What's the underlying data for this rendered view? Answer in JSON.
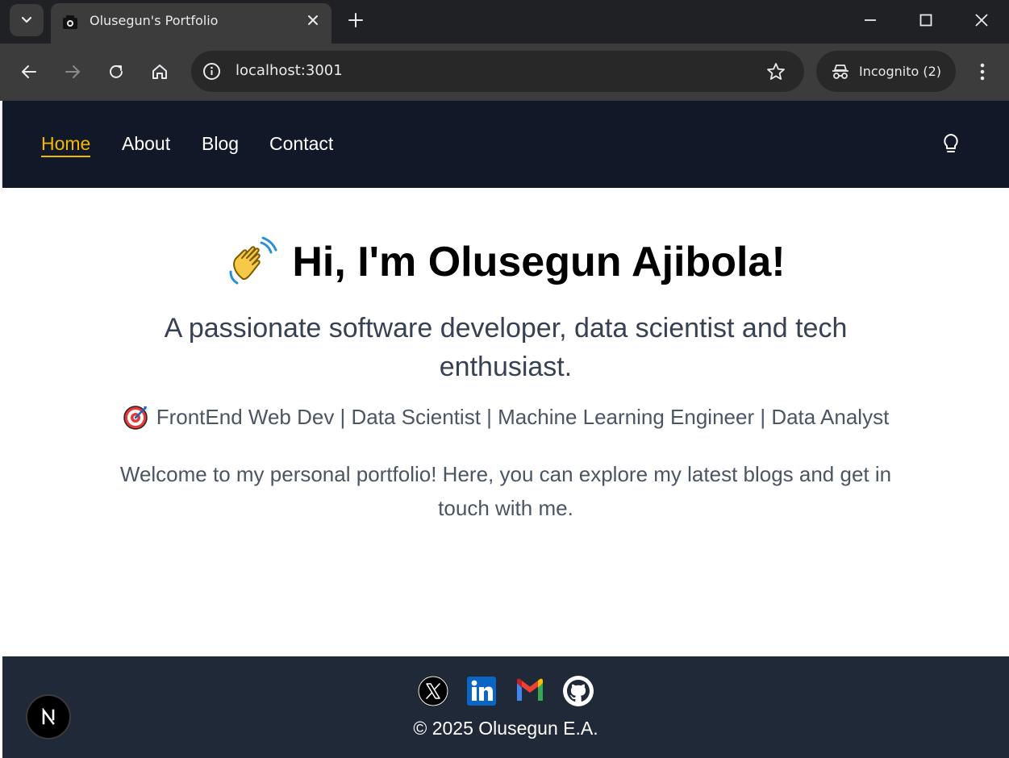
{
  "browser": {
    "tab_title": "Olusegun's Portfolio",
    "url": "localhost:3001",
    "incognito_label": "Incognito (2)"
  },
  "nav": {
    "links": [
      {
        "label": "Home",
        "active": true
      },
      {
        "label": "About",
        "active": false
      },
      {
        "label": "Blog",
        "active": false
      },
      {
        "label": "Contact",
        "active": false
      }
    ],
    "theme_icon": "lightbulb-icon",
    "accent_color": "#f5b800",
    "background": "#111827"
  },
  "hero": {
    "emoji": "waving-hand-icon",
    "title": "Hi, I'm Olusegun Ajibola!",
    "subtitle": "A passionate software developer, data scientist and tech enthusiast.",
    "roles_emoji": "target-icon",
    "roles": "FrontEnd Web Dev | Data Scientist | Machine Learning Engineer | Data Analyst",
    "welcome": "Welcome to my personal portfolio! Here, you can explore my latest blogs and get in touch with me."
  },
  "footer": {
    "socials": [
      "x-icon",
      "linkedin-icon",
      "gmail-icon",
      "github-icon"
    ],
    "copyright": "© 2025 Olusegun E.A.",
    "background": "#1f2937"
  },
  "dev_badge": {
    "letter": "N"
  }
}
